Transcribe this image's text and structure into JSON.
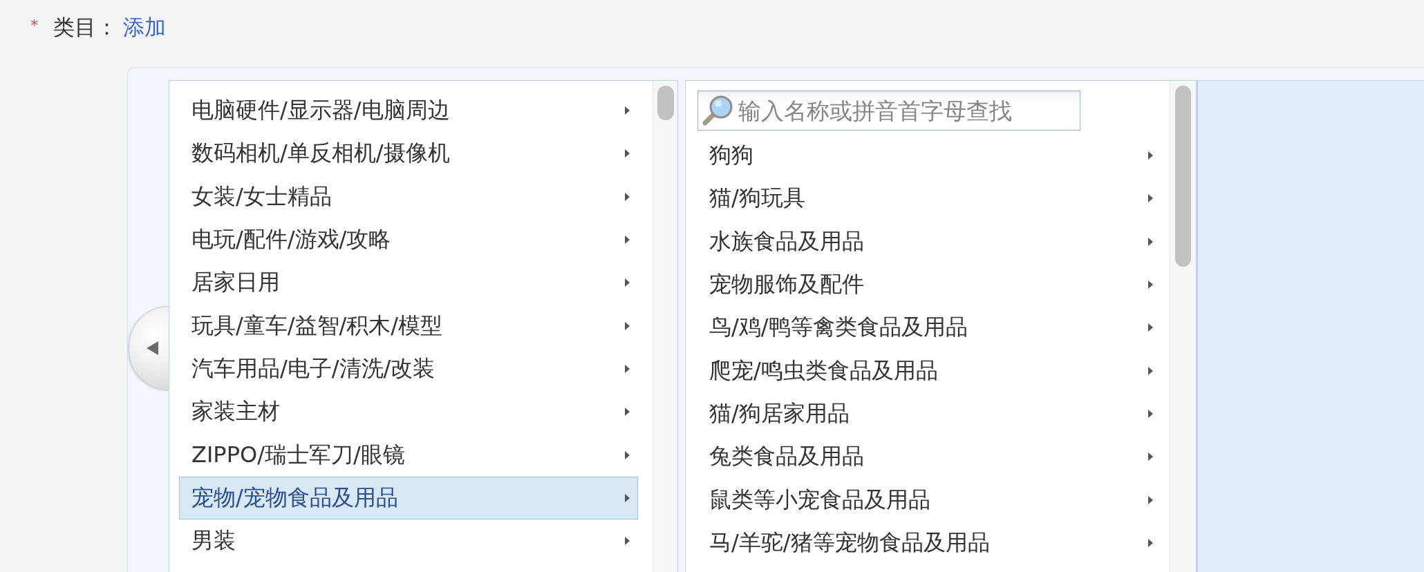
{
  "field": {
    "required_mark": "*",
    "label": "类目：",
    "link": "添加"
  },
  "columns": [
    {
      "kind": "list",
      "items": [
        {
          "label": "电脑硬件/显示器/电脑周边",
          "selected": false,
          "has_children": true
        },
        {
          "label": "数码相机/单反相机/摄像机",
          "selected": false,
          "has_children": true
        },
        {
          "label": "女装/女士精品",
          "selected": false,
          "has_children": true
        },
        {
          "label": "电玩/配件/游戏/攻略",
          "selected": false,
          "has_children": true
        },
        {
          "label": "居家日用",
          "selected": false,
          "has_children": true
        },
        {
          "label": "玩具/童车/益智/积木/模型",
          "selected": false,
          "has_children": true
        },
        {
          "label": "汽车用品/电子/清洗/改装",
          "selected": false,
          "has_children": true
        },
        {
          "label": "家装主材",
          "selected": false,
          "has_children": true
        },
        {
          "label": "ZIPPO/瑞士军刀/眼镜",
          "selected": false,
          "has_children": true
        },
        {
          "label": "宠物/宠物食品及用品",
          "selected": true,
          "has_children": true
        },
        {
          "label": "男装",
          "selected": false,
          "has_children": true
        }
      ]
    },
    {
      "kind": "list",
      "search": {
        "placeholder": "输入名称或拼音首字母查找"
      },
      "items": [
        {
          "label": "狗狗",
          "selected": false,
          "has_children": true
        },
        {
          "label": "猫/狗玩具",
          "selected": false,
          "has_children": true
        },
        {
          "label": "水族食品及用品",
          "selected": false,
          "has_children": true
        },
        {
          "label": "宠物服饰及配件",
          "selected": false,
          "has_children": true
        },
        {
          "label": "鸟/鸡/鸭等禽类食品及用品",
          "selected": false,
          "has_children": true
        },
        {
          "label": "爬宠/鸣虫类食品及用品",
          "selected": false,
          "has_children": true
        },
        {
          "label": "猫/狗居家用品",
          "selected": false,
          "has_children": true
        },
        {
          "label": "兔类食品及用品",
          "selected": false,
          "has_children": true
        },
        {
          "label": "鼠类等小宠食品及用品",
          "selected": false,
          "has_children": true
        },
        {
          "label": "马/羊驼/猪等宠物食品及用品",
          "selected": false,
          "has_children": true
        }
      ]
    },
    {
      "kind": "empty"
    }
  ]
}
